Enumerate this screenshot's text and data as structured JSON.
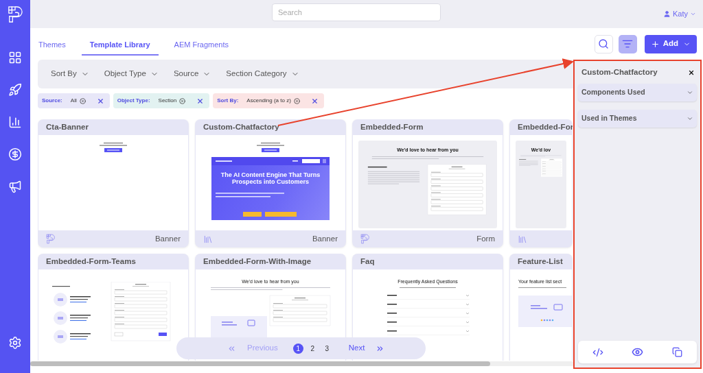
{
  "search": {
    "placeholder": "Search"
  },
  "user": {
    "name": "Katy"
  },
  "tabs": [
    {
      "label": "Themes",
      "selected": false
    },
    {
      "label": "Template Library",
      "selected": true
    },
    {
      "label": "AEM Fragments",
      "selected": false
    }
  ],
  "toolbar": {
    "filter_active": true,
    "add_label": "Add"
  },
  "filters": [
    "Sort By",
    "Object Type",
    "Source",
    "Section Category"
  ],
  "chips": [
    {
      "label": "Source:",
      "value": "All",
      "color": "#e8e7f8"
    },
    {
      "label": "Object Type:",
      "value": "Section",
      "color": "#e2f2f1"
    },
    {
      "label": "Sort By:",
      "value": "Ascending (a to z)",
      "color": "#fbe4e4"
    }
  ],
  "cards": [
    {
      "title": "Cta-Banner",
      "footer": {
        "kind": "logo",
        "category": "Banner"
      },
      "thumb": {
        "kind": "hero"
      }
    },
    {
      "title": "Custom-Chatfactory",
      "footer": {
        "kind": "stack",
        "category": "Banner"
      },
      "thumb": {
        "kind": "hero",
        "banner": {
          "title": "The AI Content Engine That Turns Prospects into Customers"
        }
      }
    },
    {
      "title": "Embedded-Form",
      "footer": {
        "kind": "logo",
        "category": "Form"
      },
      "thumb": {
        "kind": "form",
        "heading": "We'd love to hear from you"
      }
    },
    {
      "title": "Embedded-For",
      "footer": {
        "kind": "stack"
      },
      "thumb": {
        "kind": "form",
        "heading": "We'd lov"
      }
    },
    {
      "title": "Embedded-Form-Teams",
      "thumb": {
        "kind": "teams"
      }
    },
    {
      "title": "Embedded-Form-With-Image",
      "thumb": {
        "kind": "form-image",
        "heading": "We'd love to hear from you"
      }
    },
    {
      "title": "Faq",
      "thumb": {
        "kind": "faq",
        "heading": "Frequently Asked Questions"
      }
    },
    {
      "title": "Feature-List",
      "thumb": {
        "kind": "feature",
        "heading": "Your feature list sect"
      }
    }
  ],
  "pagination": {
    "previous": "Previous",
    "previous_disabled": true,
    "next": "Next",
    "pages": [
      {
        "label": "1",
        "selected": true
      },
      {
        "label": "2",
        "selected": false
      },
      {
        "label": "3",
        "selected": false
      }
    ]
  },
  "panel": {
    "title": "Custom-Chatfactory",
    "sections": [
      {
        "label": "Components Used",
        "expanded": false
      },
      {
        "label": "Used in Themes",
        "expanded": false
      }
    ]
  }
}
